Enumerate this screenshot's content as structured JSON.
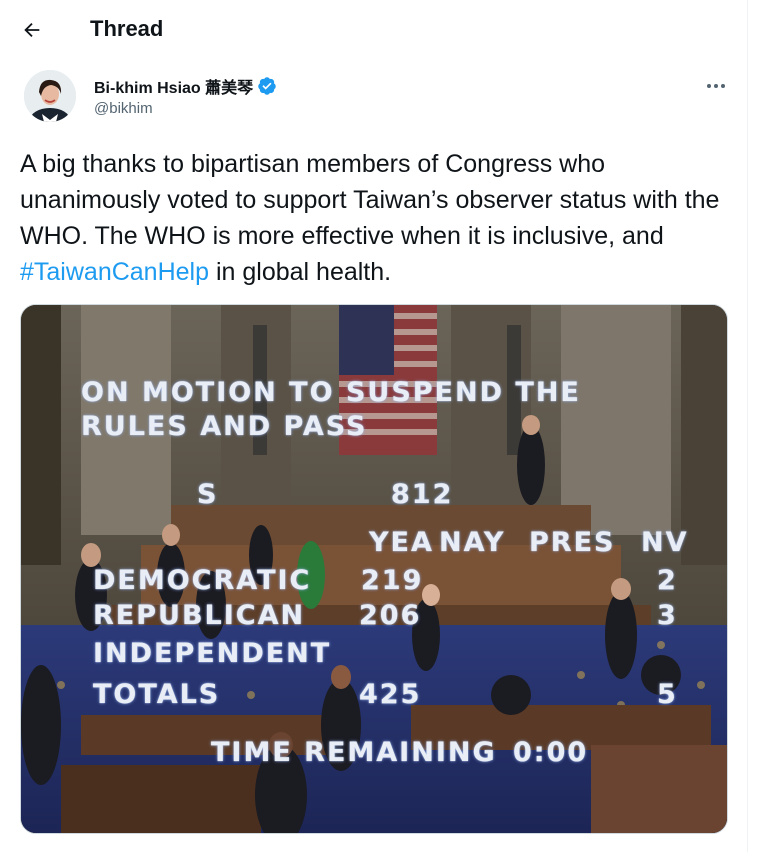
{
  "header": {
    "title": "Thread"
  },
  "author": {
    "display_name": "Bi-khim Hsiao 蕭美琴",
    "handle": "@bikhim"
  },
  "tweet": {
    "text_before": "A big thanks to bipartisan members of Congress who unanimously voted to support Taiwan’s observer status with the WHO.   The WHO is more effective when it is inclusive, and ",
    "hashtag": "#TaiwanCanHelp",
    "text_after": " in global health."
  },
  "board": {
    "motion_line1": "ON MOTION TO SUSPEND THE",
    "motion_line2": "RULES AND PASS",
    "s_label": "S",
    "s_value": "812",
    "col_yea": "YEA",
    "col_nay": "NAY",
    "col_pres": "PRES",
    "col_nv": "NV",
    "rows": [
      {
        "party": "DEMOCRATIC",
        "yea": "219",
        "nv": "2"
      },
      {
        "party": "REPUBLICAN",
        "yea": "206",
        "nv": "3"
      },
      {
        "party": "INDEPENDENT",
        "yea": "",
        "nv": ""
      },
      {
        "party": "TOTALS",
        "yea": "425",
        "nv": "5"
      }
    ],
    "time_label": "TIME REMAINING",
    "time_value": "0:00"
  },
  "colors": {
    "accent": "#1d9bf0",
    "text": "#0f1419",
    "secondary": "#536471"
  },
  "icons": {
    "back": "arrow-left-icon",
    "verified": "verified-badge-icon",
    "more": "more-horizontal-icon"
  }
}
